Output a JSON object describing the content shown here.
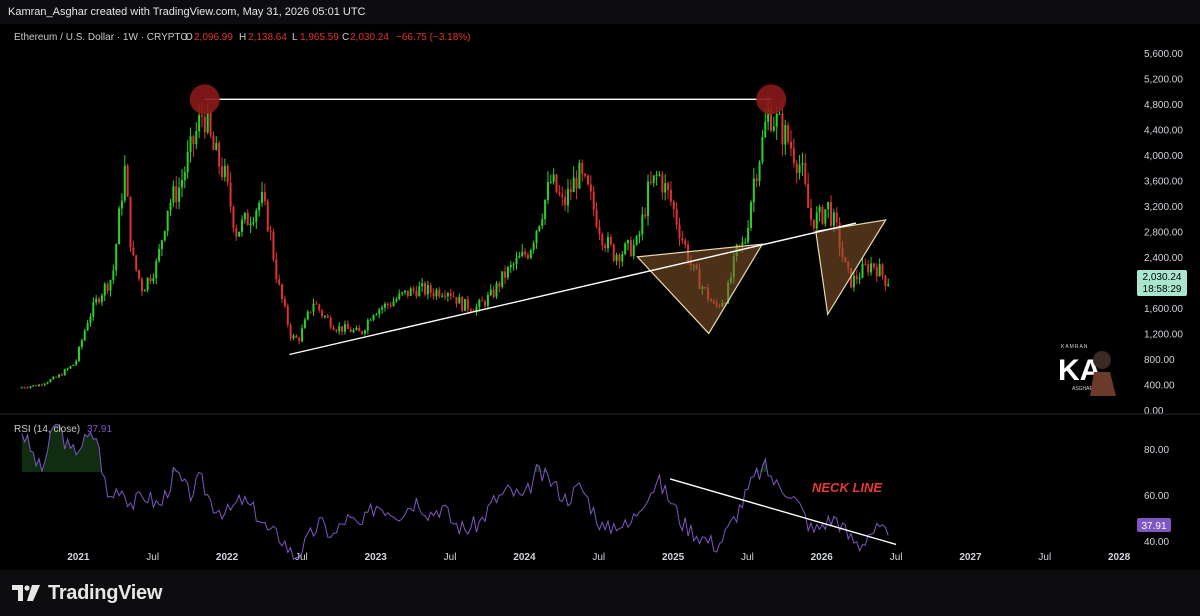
{
  "header": {
    "credit": "Kamran_Asghar created with TradingView.com, May 31, 2026 05:01 UTC"
  },
  "legend": {
    "symbol": "Ethereum / U.S. Dollar · 1W · CRYPTO",
    "o_label": "O",
    "o_value": "2,096.99",
    "h_label": "H",
    "h_value": "2,138.64",
    "l_label": "L",
    "l_value": "1,965.59",
    "c_label": "C",
    "c_value": "2,030.24",
    "change": "−66.75 (−3.18%)"
  },
  "price_badge": {
    "price": "2,030.24",
    "countdown": "18:58:29"
  },
  "rsi": {
    "label": "RSI (14, close)",
    "value": "37.91",
    "badge": "37.91",
    "ticks": [
      "80.00",
      "60.00",
      "40.00"
    ]
  },
  "annotation": {
    "neck_line": "NECK LINE"
  },
  "watermark": {
    "small": "KAMRAN",
    "big": "KA",
    "sub": "ASGHAR"
  },
  "footer": {
    "brand": "TradingView"
  },
  "colors": {
    "up": "#2bd12b",
    "down": "#e03232",
    "rsi_line": "#7e57c2",
    "price_badge_bg": "#a8e6cf",
    "rsi_badge_bg": "#7e57c2",
    "neck_line_text": "#e53935",
    "top_circle": "#8b1a1a",
    "triangle_fill": "#8b5a2b"
  },
  "chart_data": {
    "type": "candlestick",
    "title": "Ethereum / U.S. Dollar · 1W · CRYPTO",
    "y_ticks": [
      "5,600.00",
      "5,200.00",
      "4,800.00",
      "4,400.00",
      "4,000.00",
      "3,600.00",
      "3,200.00",
      "2,800.00",
      "2,400.00",
      "2,000.00",
      "1,600.00",
      "1,200.00",
      "800.00",
      "400.00",
      "0.00"
    ],
    "ylim": [
      0,
      5800
    ],
    "x_ticks": [
      "2021",
      "Jul",
      "2022",
      "Jul",
      "2023",
      "Jul",
      "2024",
      "Jul",
      "2025",
      "Jul",
      "2026",
      "Jul",
      "2027",
      "Jul",
      "2028"
    ],
    "x_tick_dates": [
      2021.0,
      2021.5,
      2022.0,
      2022.5,
      2023.0,
      2023.5,
      2024.0,
      2024.5,
      2025.0,
      2025.5,
      2026.0,
      2026.5,
      2027.0,
      2027.5,
      2028.0
    ],
    "price_path": [
      [
        2020.62,
        350
      ],
      [
        2020.75,
        390
      ],
      [
        2020.88,
        520
      ],
      [
        2021.0,
        740
      ],
      [
        2021.08,
        1400
      ],
      [
        2021.16,
        1800
      ],
      [
        2021.25,
        2100
      ],
      [
        2021.33,
        3800
      ],
      [
        2021.38,
        2400
      ],
      [
        2021.45,
        1900
      ],
      [
        2021.55,
        2300
      ],
      [
        2021.62,
        3200
      ],
      [
        2021.7,
        3500
      ],
      [
        2021.78,
        4100
      ],
      [
        2021.86,
        4700
      ],
      [
        2021.92,
        4100
      ],
      [
        2022.0,
        3700
      ],
      [
        2022.08,
        2800
      ],
      [
        2022.16,
        3000
      ],
      [
        2022.25,
        3300
      ],
      [
        2022.3,
        2900
      ],
      [
        2022.36,
        2000
      ],
      [
        2022.45,
        1150
      ],
      [
        2022.5,
        1100
      ],
      [
        2022.6,
        1700
      ],
      [
        2022.66,
        1500
      ],
      [
        2022.75,
        1300
      ],
      [
        2022.85,
        1250
      ],
      [
        2022.92,
        1200
      ],
      [
        2023.0,
        1550
      ],
      [
        2023.1,
        1650
      ],
      [
        2023.2,
        1800
      ],
      [
        2023.3,
        1900
      ],
      [
        2023.4,
        1850
      ],
      [
        2023.5,
        1900
      ],
      [
        2023.6,
        1650
      ],
      [
        2023.7,
        1600
      ],
      [
        2023.8,
        1800
      ],
      [
        2023.88,
        2100
      ],
      [
        2023.96,
        2300
      ],
      [
        2024.05,
        2500
      ],
      [
        2024.12,
        3000
      ],
      [
        2024.2,
        3600
      ],
      [
        2024.28,
        3200
      ],
      [
        2024.38,
        3700
      ],
      [
        2024.45,
        3400
      ],
      [
        2024.55,
        2700
      ],
      [
        2024.62,
        2450
      ],
      [
        2024.7,
        2500
      ],
      [
        2024.78,
        2600
      ],
      [
        2024.85,
        3400
      ],
      [
        2024.92,
        3700
      ],
      [
        2025.0,
        3300
      ],
      [
        2025.08,
        2700
      ],
      [
        2025.15,
        2200
      ],
      [
        2025.25,
        1800
      ],
      [
        2025.3,
        1600
      ],
      [
        2025.38,
        1800
      ],
      [
        2025.45,
        2500
      ],
      [
        2025.5,
        2600
      ],
      [
        2025.56,
        3600
      ],
      [
        2025.62,
        4200
      ],
      [
        2025.66,
        4700
      ],
      [
        2025.72,
        4500
      ],
      [
        2025.8,
        4200
      ],
      [
        2025.88,
        3800
      ],
      [
        2025.94,
        3000
      ],
      [
        2026.0,
        3000
      ],
      [
        2026.06,
        3200
      ],
      [
        2026.12,
        2800
      ],
      [
        2026.18,
        2200
      ],
      [
        2026.22,
        2000
      ],
      [
        2026.3,
        2200
      ],
      [
        2026.36,
        2300
      ],
      [
        2026.42,
        2150
      ],
      [
        2026.45,
        2030
      ]
    ],
    "rsi_ylim": [
      30,
      90
    ],
    "rsi_path": [
      [
        2020.62,
        88
      ],
      [
        2020.75,
        70
      ],
      [
        2020.85,
        92
      ],
      [
        2020.95,
        78
      ],
      [
        2021.05,
        84
      ],
      [
        2021.12,
        86
      ],
      [
        2021.2,
        58
      ],
      [
        2021.28,
        64
      ],
      [
        2021.36,
        56
      ],
      [
        2021.45,
        60
      ],
      [
        2021.55,
        55
      ],
      [
        2021.65,
        70
      ],
      [
        2021.75,
        60
      ],
      [
        2021.82,
        67
      ],
      [
        2021.9,
        56
      ],
      [
        2022.0,
        52
      ],
      [
        2022.1,
        58
      ],
      [
        2022.2,
        52
      ],
      [
        2022.28,
        44
      ],
      [
        2022.36,
        42
      ],
      [
        2022.45,
        33
      ],
      [
        2022.52,
        38
      ],
      [
        2022.62,
        48
      ],
      [
        2022.72,
        42
      ],
      [
        2022.8,
        50
      ],
      [
        2022.9,
        46
      ],
      [
        2023.0,
        56
      ],
      [
        2023.08,
        54
      ],
      [
        2023.16,
        52
      ],
      [
        2023.28,
        58
      ],
      [
        2023.36,
        52
      ],
      [
        2023.45,
        55
      ],
      [
        2023.52,
        48
      ],
      [
        2023.6,
        45
      ],
      [
        2023.7,
        48
      ],
      [
        2023.8,
        58
      ],
      [
        2023.9,
        62
      ],
      [
        2024.0,
        58
      ],
      [
        2024.08,
        70
      ],
      [
        2024.18,
        66
      ],
      [
        2024.28,
        58
      ],
      [
        2024.38,
        64
      ],
      [
        2024.46,
        54
      ],
      [
        2024.54,
        44
      ],
      [
        2024.62,
        48
      ],
      [
        2024.7,
        46
      ],
      [
        2024.8,
        58
      ],
      [
        2024.9,
        66
      ],
      [
        2025.0,
        56
      ],
      [
        2025.06,
        48
      ],
      [
        2025.14,
        44
      ],
      [
        2025.24,
        40
      ],
      [
        2025.3,
        38
      ],
      [
        2025.38,
        46
      ],
      [
        2025.46,
        56
      ],
      [
        2025.55,
        68
      ],
      [
        2025.62,
        72
      ],
      [
        2025.7,
        64
      ],
      [
        2025.78,
        62
      ],
      [
        2025.86,
        54
      ],
      [
        2025.94,
        44
      ],
      [
        2026.02,
        48
      ],
      [
        2026.1,
        50
      ],
      [
        2026.18,
        42
      ],
      [
        2026.26,
        38
      ],
      [
        2026.32,
        44
      ],
      [
        2026.4,
        45
      ],
      [
        2026.45,
        40
      ]
    ],
    "horizontal_line": {
      "from": [
        2021.85,
        4870
      ],
      "to": [
        2025.66,
        4870
      ]
    },
    "uptrend_line": {
      "from": [
        2022.42,
        870
      ],
      "to": [
        2026.23,
        2930
      ]
    },
    "rsi_trend_line": {
      "from": [
        2024.98,
        67
      ],
      "to": [
        2026.5,
        38.5
      ]
    },
    "top_markers": [
      [
        2021.85,
        4870
      ],
      [
        2025.66,
        4870
      ]
    ],
    "triangles": [
      {
        "points": [
          [
            2024.76,
            2400
          ],
          [
            2025.6,
            2600
          ],
          [
            2025.24,
            1200
          ]
        ]
      },
      {
        "points": [
          [
            2025.96,
            2800
          ],
          [
            2026.43,
            2980
          ],
          [
            2026.04,
            1500
          ]
        ]
      }
    ]
  }
}
